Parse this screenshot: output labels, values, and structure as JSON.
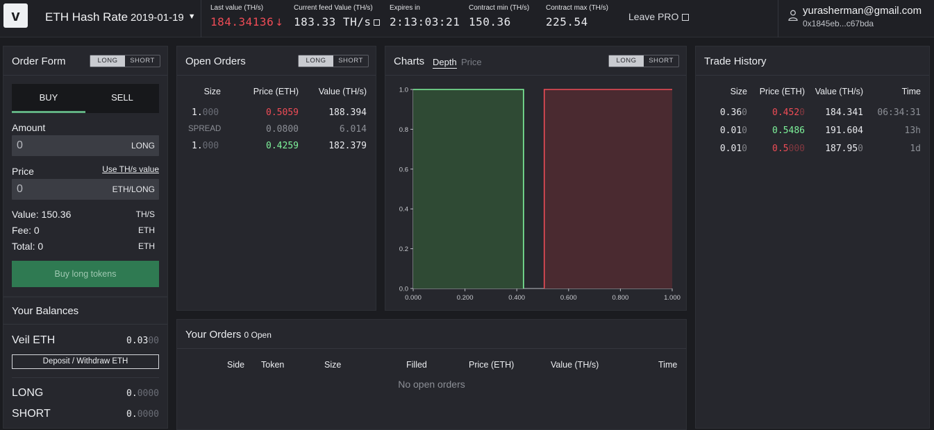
{
  "header": {
    "logo": "v",
    "market": "ETH Hash Rate",
    "date": "2019-01-19",
    "last_value": {
      "label": "Last value (TH/s)",
      "value": "184.34136",
      "arrow": "↓"
    },
    "feed_value": {
      "label": "Current feed Value (TH/s)",
      "value": "183.33 TH/s"
    },
    "expires": {
      "label": "Expires in",
      "value": "2:13:03:21"
    },
    "contract_min": {
      "label": "Contract min (TH/s)",
      "value": "150.36"
    },
    "contract_max": {
      "label": "Contract max (TH/s)",
      "value": "225.54"
    },
    "leave_pro": "Leave PRO",
    "user": {
      "email": "yurasherman@gmail.com",
      "address": "0x1845eb...c67bda"
    }
  },
  "toggle": {
    "long": "LONG",
    "short": "SHORT"
  },
  "order_form": {
    "title": "Order Form",
    "buy": "BUY",
    "sell": "SELL",
    "amount_label": "Amount",
    "amount_value": "0",
    "amount_unit": "LONG",
    "price_label": "Price",
    "use_ths": "Use TH/s value",
    "price_value": "0",
    "price_unit": "ETH/LONG",
    "value": {
      "label": "Value: 150.36",
      "unit": "TH/S"
    },
    "fee": {
      "label": "Fee: 0",
      "unit": "ETH"
    },
    "total": {
      "label": "Total: 0",
      "unit": "ETH"
    },
    "buy_button": "Buy long tokens"
  },
  "balances": {
    "title": "Your Balances",
    "veil_eth": {
      "label": "Veil ETH",
      "value": "0.03",
      "dim": "00"
    },
    "deposit_button": "Deposit / Withdraw ETH",
    "long": {
      "label": "LONG",
      "value": "0.",
      "dim": "0000"
    },
    "short": {
      "label": "SHORT",
      "value": "0.",
      "dim": "0000"
    }
  },
  "open_orders": {
    "title": "Open Orders",
    "headers": [
      "Size",
      "Price (ETH)",
      "Value (TH/s)"
    ],
    "rows": [
      {
        "size": "1.",
        "size_dim": "000",
        "price": "0.5059",
        "value": "188.394"
      },
      {
        "size": "SPREAD",
        "price": "0.0800",
        "value": "6.014"
      },
      {
        "size": "1.",
        "size_dim": "000",
        "price": "0.4259",
        "value": "182.379"
      }
    ]
  },
  "charts": {
    "title": "Charts",
    "tab_depth": "Depth",
    "tab_price": "Price",
    "y_ticks": [
      "1.0",
      "0.8",
      "0.6",
      "0.4",
      "0.2",
      "0.0"
    ],
    "x_ticks": [
      "0.000",
      "0.200",
      "0.400",
      "0.600",
      "0.800",
      "1.000"
    ]
  },
  "chart_data": {
    "type": "area",
    "xlim": [
      0,
      1
    ],
    "ylim": [
      0,
      1
    ],
    "series": [
      {
        "side": "bid",
        "color": "#7ef39b",
        "x": [
          0,
          0.426,
          0.426
        ],
        "y": [
          1,
          1,
          0
        ]
      },
      {
        "side": "ask",
        "color": "#ef4c56",
        "x": [
          0.506,
          0.506,
          1
        ],
        "y": [
          0,
          1,
          1
        ]
      }
    ]
  },
  "your_orders": {
    "title": "Your Orders",
    "count": "0 Open",
    "headers": [
      "Side",
      "Token",
      "Size",
      "Filled",
      "Price (ETH)",
      "Value (TH/s)",
      "Time"
    ],
    "empty": "No open orders"
  },
  "trade_history": {
    "title": "Trade History",
    "headers": [
      "Size",
      "Price (ETH)",
      "Value (TH/s)",
      "Time"
    ],
    "rows": [
      {
        "size": "0.36",
        "size_dim": "0",
        "price": "0.452",
        "price_dim": "0",
        "price_color": "red",
        "value": "184.341",
        "value_dim": "",
        "time": "06:34:31"
      },
      {
        "size": "0.01",
        "size_dim": "0",
        "price": "0.5486",
        "price_dim": "",
        "price_color": "green",
        "value": "191.604",
        "value_dim": "",
        "time": "13h"
      },
      {
        "size": "0.01",
        "size_dim": "0",
        "price": "0.5",
        "price_dim": "000",
        "price_color": "red",
        "value": "187.95",
        "value_dim": "0",
        "time": "1d"
      }
    ]
  }
}
